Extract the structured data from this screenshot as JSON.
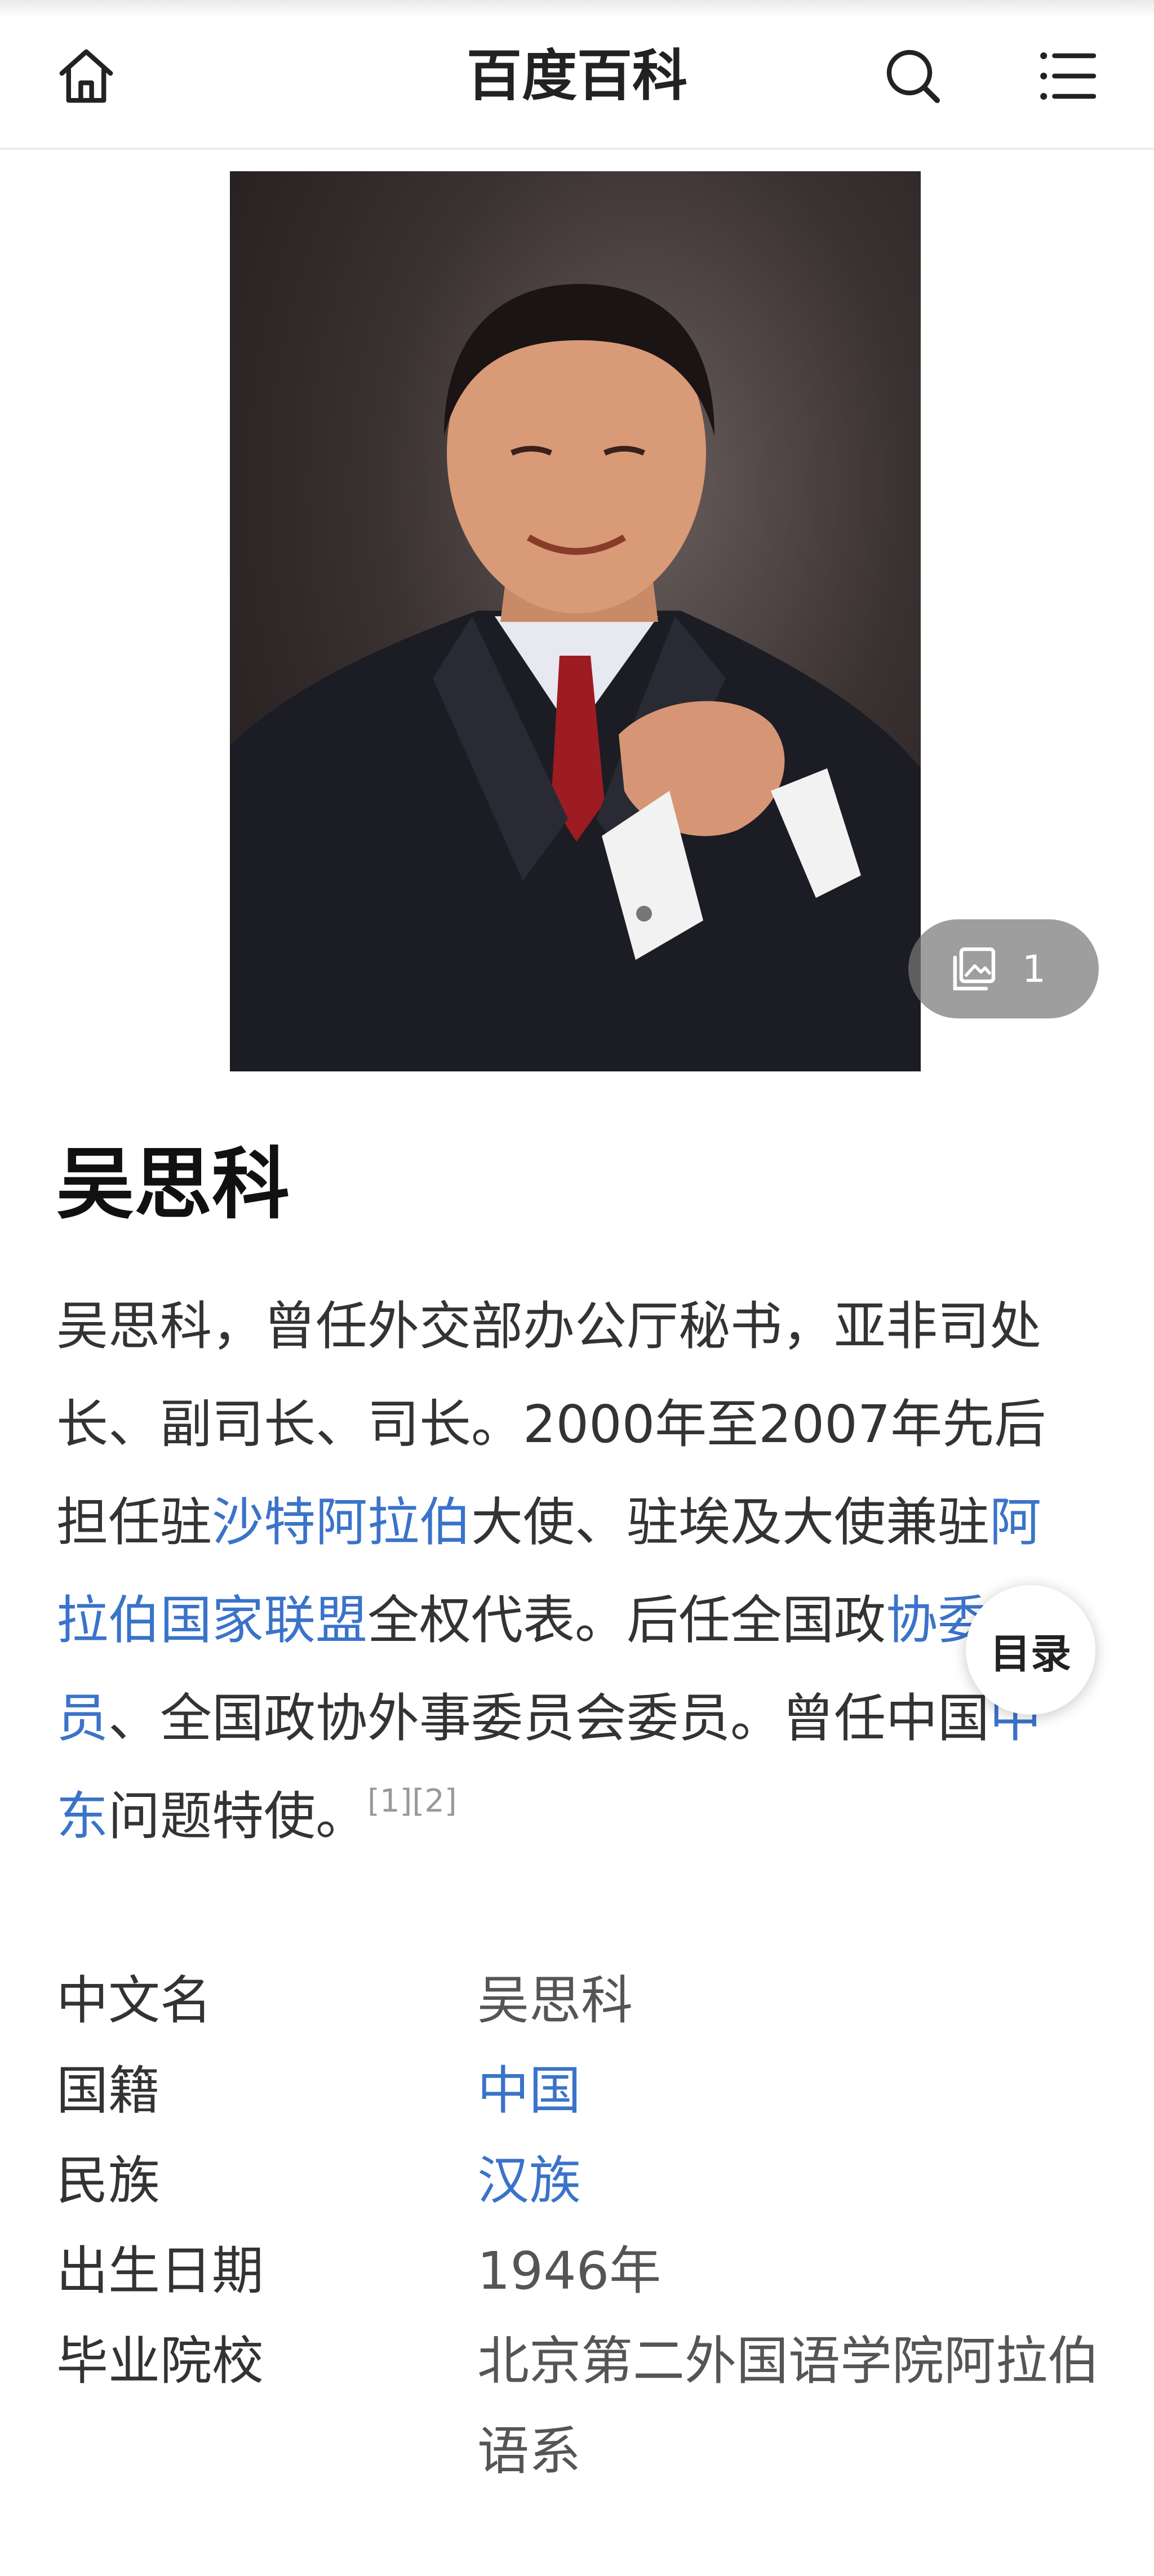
{
  "header": {
    "site_title": "百度百科"
  },
  "photo": {
    "gallery_count": "1"
  },
  "entry": {
    "title": "吴思科"
  },
  "summary": {
    "p1": "吴思科，曾任外交部办公厅秘书，亚非司处长、副司长、司长。2000年至2007年先后担任驻",
    "link1": "沙特阿拉伯",
    "p2": "大使、驻埃及大使兼驻",
    "link2": "阿拉伯国家联盟",
    "p3": "全权代表。后任全国政",
    "link3": "协委员",
    "p4": "、全国政协外事委员会委员。曾任中国",
    "link4": "中东",
    "p5": "问题特使。",
    "ref": "[1][2]"
  },
  "toc": {
    "label": "目录"
  },
  "basic_info": [
    {
      "label": "中文名",
      "value": "吴思科"
    },
    {
      "label": "国籍",
      "value": "中国"
    },
    {
      "label": "民族",
      "value": "汉族"
    },
    {
      "label": "出生日期",
      "value": "1946年"
    },
    {
      "label": "毕业院校",
      "value": "北京第二外国语学院阿拉伯语系"
    }
  ],
  "colors": {
    "link": "#3a73c9",
    "text": "#333333",
    "title": "#111111"
  },
  "icons": {
    "home": "home-icon",
    "search": "search-icon",
    "menu": "menu-icon",
    "gallery": "gallery-icon"
  }
}
